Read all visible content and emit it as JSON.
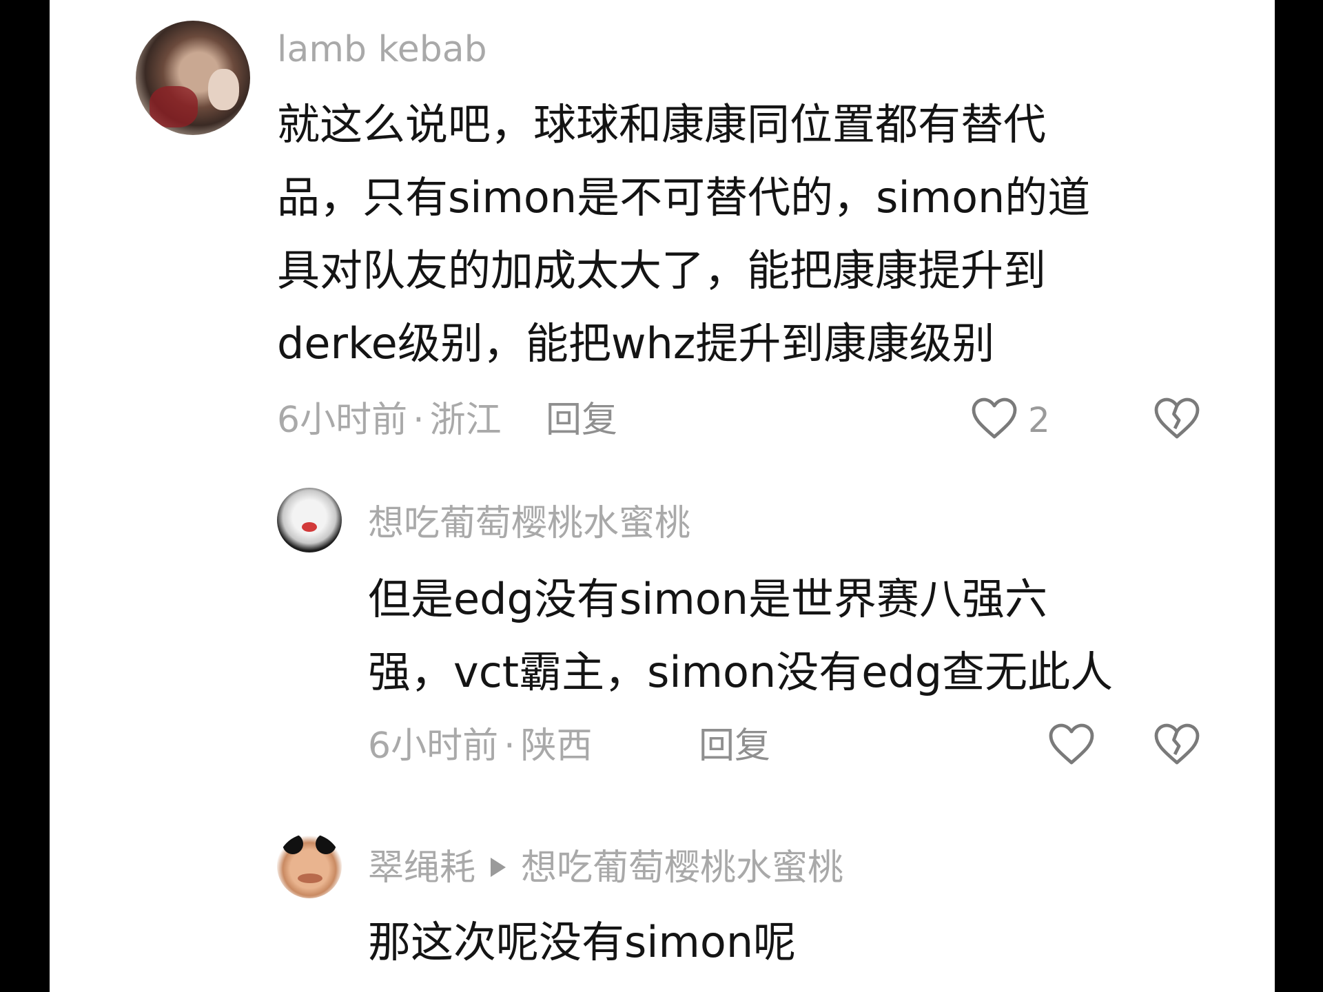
{
  "comments": [
    {
      "username": "lamb kebab",
      "lines": [
        "就这么说吧，球球和康康同位置都有替代",
        "品，只有simon是不可替代的，simon的道",
        "具对队友的加成太大了，能把康康提升到",
        "derke级别，能把whz提升到康康级别"
      ],
      "time": "6小时前",
      "location": "浙江",
      "reply_label": "回复",
      "like_count": "2"
    },
    {
      "username": "想吃葡萄樱桃水蜜桃",
      "lines": [
        "但是edg没有simon是世界赛八强六",
        "强，vct霸主，simon没有edg查无此人"
      ],
      "time": "6小时前",
      "location": "陕西",
      "reply_label": "回复"
    },
    {
      "username": "翠绳耗",
      "reply_to": "想吃葡萄樱桃水蜜桃",
      "lines": [
        "那这次呢没有simon呢"
      ]
    }
  ],
  "meta_separator": "·",
  "icons": {
    "like": "heart-outline-icon",
    "dislike": "broken-heart-icon",
    "reply_arrow": "triangle-right-icon"
  },
  "colors": {
    "text": "#141414",
    "muted": "#a9a9a9",
    "background": "#ffffff"
  }
}
